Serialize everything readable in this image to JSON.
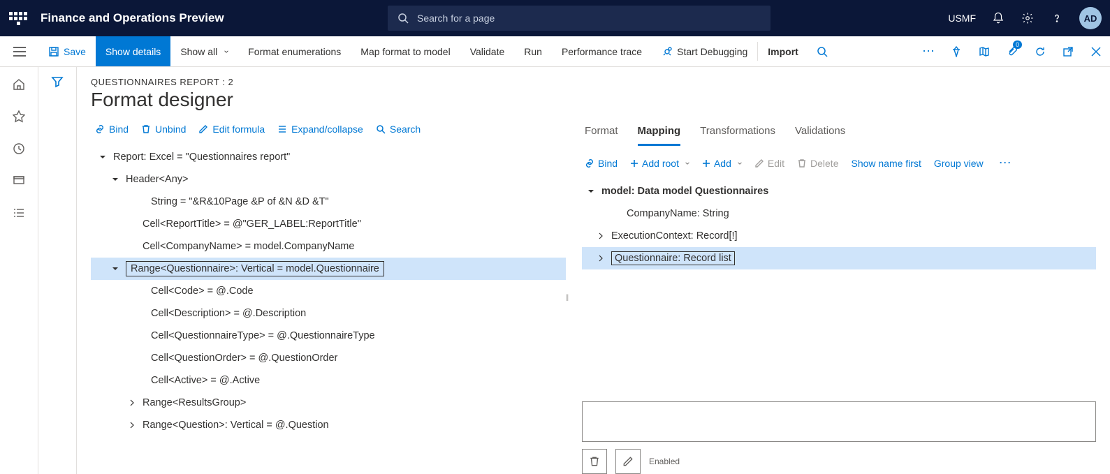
{
  "topbar": {
    "app_title": "Finance and Operations Preview",
    "search_placeholder": "Search for a page",
    "entity": "USMF",
    "avatar": "AD"
  },
  "actions": {
    "save": "Save",
    "show_details": "Show details",
    "show_all": "Show all",
    "format_enum": "Format enumerations",
    "map_format": "Map format to model",
    "validate": "Validate",
    "run": "Run",
    "perf_trace": "Performance trace",
    "start_debug": "Start Debugging",
    "import": "Import"
  },
  "page": {
    "subtitle": "QUESTIONNAIRES REPORT : 2",
    "title": "Format designer"
  },
  "left_toolbar": {
    "bind": "Bind",
    "unbind": "Unbind",
    "edit_formula": "Edit formula",
    "expand": "Expand/collapse",
    "search": "Search"
  },
  "tree_left": {
    "n0": "Report: Excel = \"Questionnaires report\"",
    "n1": "Header<Any>",
    "n2": "String = \"&R&10Page &P of &N &D &T\"",
    "n3": "Cell<ReportTitle> = @\"GER_LABEL:ReportTitle\"",
    "n4": "Cell<CompanyName> = model.CompanyName",
    "n5": "Range<Questionnaire>: Vertical = model.Questionnaire",
    "n6": "Cell<Code> = @.Code",
    "n7": "Cell<Description> = @.Description",
    "n8": "Cell<QuestionnaireType> = @.QuestionnaireType",
    "n9": "Cell<QuestionOrder> = @.QuestionOrder",
    "n10": "Cell<Active> = @.Active",
    "n11": "Range<ResultsGroup>",
    "n12": "Range<Question>: Vertical = @.Question"
  },
  "tabs": {
    "format": "Format",
    "mapping": "Mapping",
    "transformations": "Transformations",
    "validations": "Validations"
  },
  "right_toolbar": {
    "bind": "Bind",
    "add_root": "Add root",
    "add": "Add",
    "edit": "Edit",
    "delete": "Delete",
    "show_name": "Show name first",
    "group": "Group view"
  },
  "tree_right": {
    "m0": "model: Data model Questionnaires",
    "m1": "CompanyName: String",
    "m2": "ExecutionContext: Record[!]",
    "m3": "Questionnaire: Record list"
  },
  "bottom": {
    "enabled": "Enabled"
  }
}
